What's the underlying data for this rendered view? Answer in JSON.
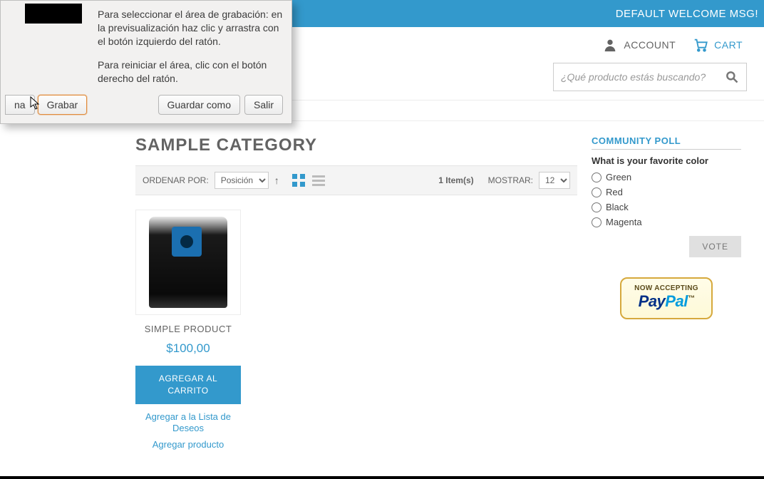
{
  "welcome": "DEFAULT WELCOME MSG!",
  "header": {
    "account": "ACCOUNT",
    "cart": "CART"
  },
  "search": {
    "placeholder": "¿Qué producto estás buscando?"
  },
  "breadcrumb": "SAMPLE CATEGORY",
  "page_title": "SAMPLE CATEGORY",
  "toolbar": {
    "sort_by_label": "ORDENAR POR:",
    "sort_by_value": "Posición",
    "item_count": "1 Item(s)",
    "show_label": "MOSTRAR:",
    "show_value": "12"
  },
  "product": {
    "name": "SIMPLE PRODUCT",
    "price": "$100,00",
    "add_to_cart": "AGREGAR AL CARRITO",
    "add_to_wishlist": "Agregar a la Lista de Deseos",
    "add_to_compare": "Agregar producto"
  },
  "poll": {
    "title": "COMMUNITY POLL",
    "question": "What is your favorite color",
    "options": [
      "Green",
      "Red",
      "Black",
      "Magenta"
    ],
    "vote_label": "VOTE"
  },
  "paypal": {
    "accepting": "NOW ACCEPTING",
    "logo_part1": "Pay",
    "logo_part2": "Pal",
    "tm": "™"
  },
  "recorder": {
    "text1": "Para seleccionar el área de grabación: en la previsualización haz clic y arrastra con el botón izquierdo del ratón.",
    "text2": "Para reiniciar el área, clic con el botón derecho del ratón.",
    "btn_window": "na",
    "btn_record": "Grabar",
    "btn_save_as": "Guardar como",
    "btn_exit": "Salir"
  }
}
